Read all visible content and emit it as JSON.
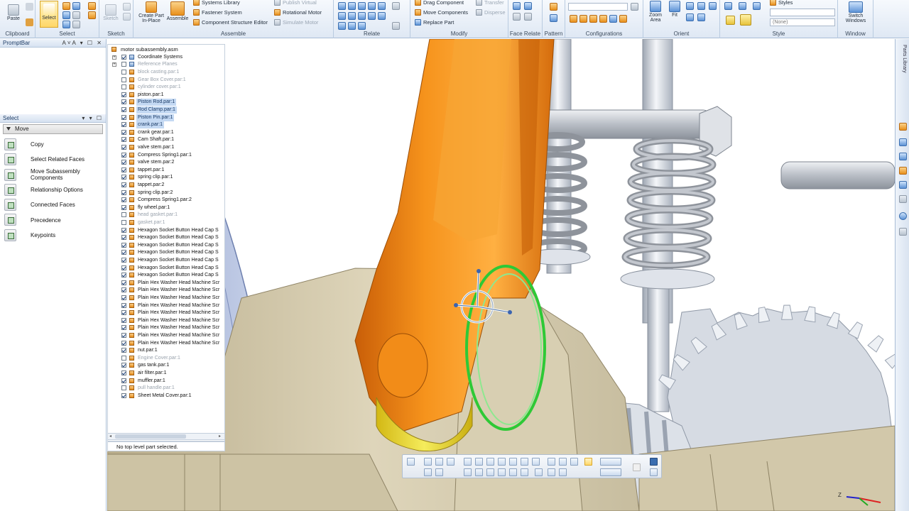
{
  "ribbon": {
    "clipboard": {
      "paste": "Paste",
      "label": "Clipboard"
    },
    "select": {
      "select": "Select",
      "label": "Select"
    },
    "sketch": {
      "sketch": "Sketch",
      "label": "Sketch"
    },
    "assemble": {
      "create_part": "Create Part\nIn-Place",
      "assemble": "Assemble",
      "systems_library": "Systems Library",
      "fastener_system": "Fastener System",
      "component_structure_editor": "Component Structure Editor",
      "publish_virtual": "Publish Virtual",
      "rotational_motor": "Rotational Motor",
      "simulate_motor": "Simulate Motor",
      "label": "Assemble"
    },
    "relate": {
      "label": "Relate"
    },
    "modify": {
      "drag_component": "Drag Component",
      "move_components": "Move Components",
      "replace_part": "Replace Part",
      "transfer": "Transfer",
      "disperse": "Disperse",
      "label": "Modify"
    },
    "face_relate": {
      "label": "Face Relate"
    },
    "pattern": {
      "label": "Pattern"
    },
    "configurations": {
      "label": "Configurations"
    },
    "orient": {
      "zoom_area": "Zoom\nArea",
      "fit": "Fit",
      "label": "Orient"
    },
    "style": {
      "styles": "Styles",
      "none_option": "(None)",
      "label": "Style"
    },
    "window": {
      "switch_windows": "Switch\nWindows",
      "label": "Window"
    }
  },
  "promptbar": {
    "title": "PromptBar"
  },
  "select_panel": {
    "title": "Select",
    "mode": "Move",
    "commands": [
      "Copy",
      "Select Related Faces",
      "Move Subassembly Components",
      "Relationship Options",
      "Connected Faces",
      "Precedence",
      "Keypoints"
    ]
  },
  "tree": {
    "root": "motor subassembly.asm",
    "items": [
      {
        "label": "Coordinate Systems",
        "checked": true,
        "state": "sys",
        "expander": "+"
      },
      {
        "label": "Reference Planes",
        "checked": false,
        "state": "sysdim",
        "expander": "+"
      },
      {
        "label": "block casting.par:1",
        "checked": false,
        "state": "dim"
      },
      {
        "label": "Gear Box Cover.par:1",
        "checked": false,
        "state": "dim"
      },
      {
        "label": "cylinder cover.par:1",
        "checked": false,
        "state": "dim"
      },
      {
        "label": "piston.par:1",
        "checked": true,
        "state": "normal"
      },
      {
        "label": "Piston Rod.par:1",
        "checked": true,
        "state": "hl"
      },
      {
        "label": "Rod Clamp.par:1",
        "checked": true,
        "state": "hl"
      },
      {
        "label": "Piston Pin.par:1",
        "checked": true,
        "state": "hl"
      },
      {
        "label": "crank.par:1",
        "checked": true,
        "state": "hl"
      },
      {
        "label": "crank gear.par:1",
        "checked": true,
        "state": "normal"
      },
      {
        "label": "Cam Shaft.par:1",
        "checked": true,
        "state": "normal"
      },
      {
        "label": "valve stem.par:1",
        "checked": true,
        "state": "normal"
      },
      {
        "label": "Compress Spring1.par:1",
        "checked": true,
        "state": "normal"
      },
      {
        "label": "valve stem.par:2",
        "checked": true,
        "state": "normal"
      },
      {
        "label": "tappet.par:1",
        "checked": true,
        "state": "normal"
      },
      {
        "label": "spring clip.par:1",
        "checked": true,
        "state": "normal"
      },
      {
        "label": "tappet.par:2",
        "checked": true,
        "state": "normal"
      },
      {
        "label": "spring clip.par:2",
        "checked": true,
        "state": "normal"
      },
      {
        "label": "Compress Spring1.par:2",
        "checked": true,
        "state": "normal"
      },
      {
        "label": "fly wheel.par:1",
        "checked": true,
        "state": "normal"
      },
      {
        "label": "head gasket.par:1",
        "checked": false,
        "state": "dim"
      },
      {
        "label": "gasket.par:1",
        "checked": false,
        "state": "dim"
      },
      {
        "label": "Hexagon Socket Button Head Cap S",
        "checked": true,
        "state": "normal"
      },
      {
        "label": "Hexagon Socket Button Head Cap S",
        "checked": true,
        "state": "normal"
      },
      {
        "label": "Hexagon Socket Button Head Cap S",
        "checked": true,
        "state": "normal"
      },
      {
        "label": "Hexagon Socket Button Head Cap S",
        "checked": true,
        "state": "normal"
      },
      {
        "label": "Hexagon Socket Button Head Cap S",
        "checked": true,
        "state": "normal"
      },
      {
        "label": "Hexagon Socket Button Head Cap S",
        "checked": true,
        "state": "normal"
      },
      {
        "label": "Hexagon Socket Button Head Cap S",
        "checked": true,
        "state": "normal"
      },
      {
        "label": "Plain Hex Washer Head Machine Scr",
        "checked": true,
        "state": "normal"
      },
      {
        "label": "Plain Hex Washer Head Machine Scr",
        "checked": true,
        "state": "normal"
      },
      {
        "label": "Plain Hex Washer Head Machine Scr",
        "checked": true,
        "state": "normal"
      },
      {
        "label": "Plain Hex Washer Head Machine Scr",
        "checked": true,
        "state": "normal"
      },
      {
        "label": "Plain Hex Washer Head Machine Scr",
        "checked": true,
        "state": "normal"
      },
      {
        "label": "Plain Hex Washer Head Machine Scr",
        "checked": true,
        "state": "normal"
      },
      {
        "label": "Plain Hex Washer Head Machine Scr",
        "checked": true,
        "state": "normal"
      },
      {
        "label": "Plain Hex Washer Head Machine Scr",
        "checked": true,
        "state": "normal"
      },
      {
        "label": "Plain Hex Washer Head Machine Scr",
        "checked": true,
        "state": "normal"
      },
      {
        "label": "nut.par:1",
        "checked": true,
        "state": "normal"
      },
      {
        "label": "Engine Cover.par:1",
        "checked": false,
        "state": "dim"
      },
      {
        "label": "gas tank.par:1",
        "checked": true,
        "state": "normal"
      },
      {
        "label": "air filter.par:1",
        "checked": true,
        "state": "normal"
      },
      {
        "label": "muffler.par:1",
        "checked": true,
        "state": "normal"
      },
      {
        "label": "pull handle.par:1",
        "checked": false,
        "state": "dim"
      },
      {
        "label": "Sheet Metal Cover.par:1",
        "checked": true,
        "state": "normal"
      }
    ],
    "status": "No top level part selected."
  },
  "viewport": {
    "triad_z": "Z",
    "colors": {
      "part_orange": "#f08a16",
      "part_yellow": "#e8dc2a",
      "casting_tan": "#d8cfb2",
      "steel": "#cfd4dc",
      "select_green": "#34d13a",
      "blue_cover": "#a7b6d9"
    }
  }
}
